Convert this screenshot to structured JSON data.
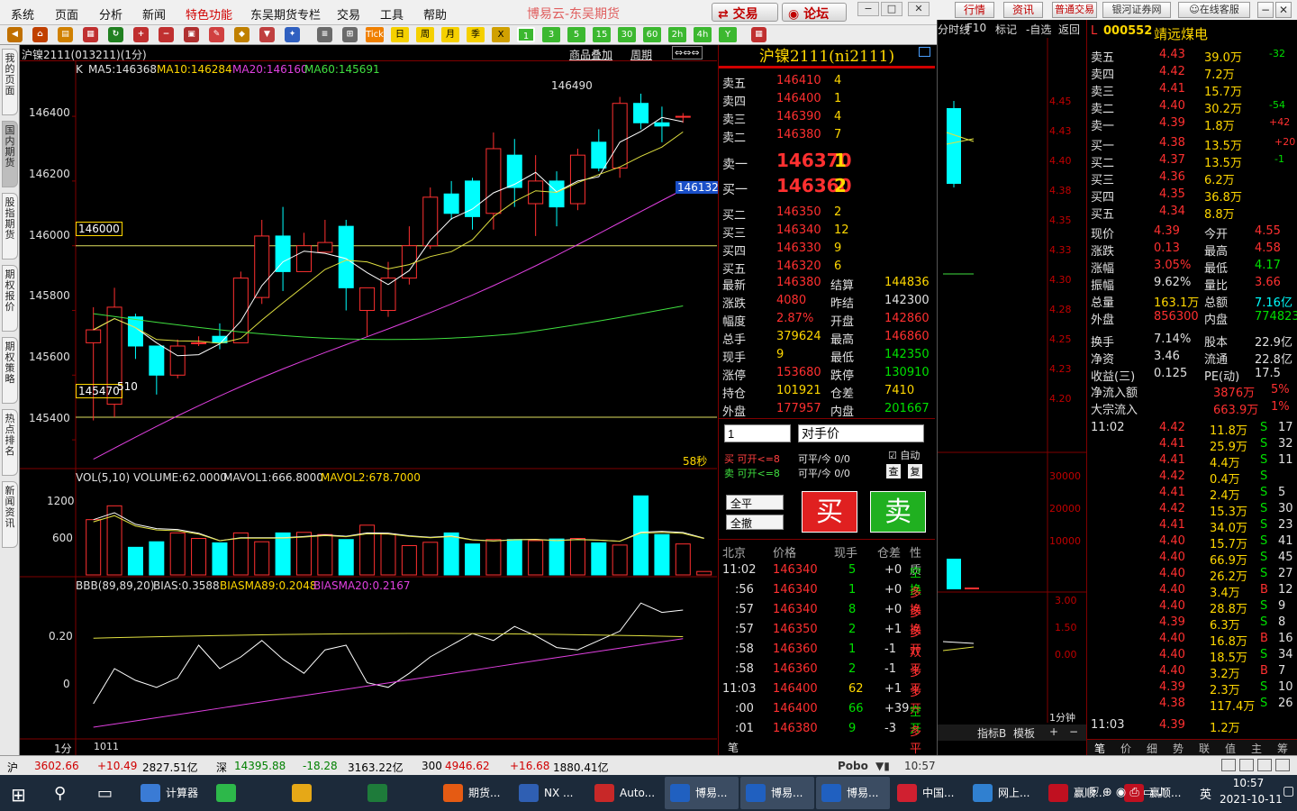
{
  "menu": {
    "items": [
      "系统",
      "页面",
      "分析",
      "新闻",
      "特色功能",
      "东吴期货专栏",
      "交易",
      "工具",
      "帮助"
    ],
    "title": "博易云-东吴期货",
    "trade_btn": "交易",
    "forum_btn": "论坛"
  },
  "toolbar": {
    "periods": [
      "1",
      "3",
      "5",
      "15",
      "30",
      "60",
      "2h",
      "4h",
      "Y"
    ],
    "tick": "Tick",
    "day": "日",
    "week": "周",
    "month": "月",
    "season": "季"
  },
  "sidetabs": [
    "我的页面",
    "国内期货",
    "股指期货",
    "期权报价",
    "期权策略",
    "热点排名",
    "新闻资讯"
  ],
  "chart": {
    "header": "沪镍2111(013211)(1分)",
    "overlay": "商品叠加",
    "period": "周期",
    "ma_label": "K",
    "ma5": "MA5:146368",
    "ma10": "MA10:146284",
    "ma20": "MA20:146160",
    "ma60": "MA60:145691",
    "high_label": "146490",
    "line1_label": "146000",
    "line2_label": "145470",
    "current_price_tag": "146132",
    "countdown": "58秒",
    "low_label_tail": "510",
    "vol_title": "VOL(5,10)",
    "vol_volume": "VOLUME:62.0000",
    "vol_mavol1": "MAVOL1:666.8000",
    "vol_mavol2": "MAVOL2:678.7000",
    "bbb_title": "BBB(89,89,20)",
    "bbb_bias": "BIAS:0.3588",
    "bbb_bma89": "BIASMA89:0.2048",
    "bbb_bma20": "BIASMA20:0.2167",
    "xaxis_period": "1分",
    "xaxis_time": "1011",
    "yticks": [
      "146400",
      "146200",
      "146000",
      "145800",
      "145600",
      "145400"
    ],
    "vol_yticks": [
      "1200",
      "600"
    ],
    "bbb_yticks": [
      "0.20",
      "0"
    ]
  },
  "chart_data": {
    "type": "candlestick",
    "title": "沪镍2111(013211)(1分)",
    "ylim": [
      145300,
      146520
    ],
    "candles": [
      [
        145700,
        145740,
        145500,
        145460,
        145810
      ],
      [
        145510,
        145810,
        145520,
        145470,
        145870
      ],
      [
        145780,
        145690,
        145690,
        145650,
        145790
      ],
      [
        145690,
        145600,
        145600,
        145540,
        145680
      ],
      [
        145600,
        145690,
        145690,
        145590,
        145710
      ],
      [
        145700,
        145700,
        145710,
        145690,
        145720
      ],
      [
        145720,
        145700,
        145730,
        145680,
        145760
      ],
      [
        145700,
        145900,
        145900,
        145700,
        145920
      ],
      [
        145840,
        146030,
        146030,
        145820,
        146080
      ],
      [
        146030,
        145920,
        145920,
        145860,
        146120
      ],
      [
        145920,
        146000,
        146000,
        145920,
        146040
      ],
      [
        145980,
        146010,
        146040,
        145980,
        146080
      ],
      [
        146060,
        145870,
        145870,
        145800,
        146080
      ],
      [
        145800,
        145870,
        145870,
        145720,
        145870
      ],
      [
        145800,
        145900,
        145900,
        145780,
        145950
      ],
      [
        145900,
        146000,
        146000,
        145880,
        146060
      ],
      [
        146000,
        146150,
        146150,
        145990,
        146180
      ],
      [
        146160,
        146100,
        146180,
        146080,
        146200
      ],
      [
        146200,
        146090,
        146200,
        146050,
        146210
      ],
      [
        146100,
        146300,
        146300,
        146050,
        146350
      ],
      [
        146280,
        146180,
        146280,
        146120,
        146330
      ],
      [
        146130,
        146200,
        146200,
        146030,
        146280
      ],
      [
        146200,
        146120,
        146220,
        146060,
        146230
      ],
      [
        146130,
        146280,
        146280,
        146110,
        146300
      ],
      [
        146320,
        146240,
        146350,
        146230,
        146360
      ],
      [
        146240,
        146440,
        146440,
        146210,
        146460
      ],
      [
        146440,
        146380,
        146440,
        146360,
        146470
      ],
      [
        146380,
        146370,
        146380,
        146320,
        146430
      ],
      [
        146400,
        146400,
        146410,
        146380,
        146410
      ]
    ],
    "volume": [
      1000,
      1250,
      500,
      600,
      760,
      660,
      580,
      760,
      600,
      760,
      770,
      730,
      640,
      900,
      740,
      530,
      590,
      760,
      560,
      640,
      640,
      620,
      650,
      660,
      580,
      540,
      1430,
      730,
      560,
      62
    ]
  },
  "orderbook": {
    "title": "沪镍2111(ni2111)",
    "asks": [
      {
        "label": "卖五",
        "price": "146410",
        "vol": "4"
      },
      {
        "label": "卖四",
        "price": "146400",
        "vol": "1"
      },
      {
        "label": "卖三",
        "price": "146390",
        "vol": "4"
      },
      {
        "label": "卖二",
        "price": "146380",
        "vol": "7"
      },
      {
        "label": "卖一",
        "price": "146370",
        "vol": "1"
      }
    ],
    "bids": [
      {
        "label": "买一",
        "price": "146360",
        "vol": "2"
      },
      {
        "label": "买二",
        "price": "146350",
        "vol": "2"
      },
      {
        "label": "买三",
        "price": "146340",
        "vol": "12"
      },
      {
        "label": "买四",
        "price": "146330",
        "vol": "9"
      },
      {
        "label": "买五",
        "price": "146320",
        "vol": "6"
      }
    ],
    "stats": [
      [
        "最新",
        "146380",
        "结算",
        "144836"
      ],
      [
        "涨跌",
        "4080",
        "昨结",
        "142300"
      ],
      [
        "幅度",
        "2.87%",
        "开盘",
        "142860"
      ],
      [
        "总手",
        "379624",
        "最高",
        "146860"
      ],
      [
        "现手",
        "9",
        "最低",
        "142350"
      ],
      [
        "涨停",
        "153680",
        "跌停",
        "130910"
      ],
      [
        "持仓",
        "101921",
        "仓差",
        "7410"
      ],
      [
        "外盘",
        "177957",
        "内盘",
        "201667"
      ]
    ],
    "qty": "1",
    "price_type": "对手价",
    "buy_open": "买 可开<=8",
    "sell_open": "卖 可开<=8",
    "close1": "可平/今 0/0",
    "close2": "可平/今 0/0",
    "auto": "自动",
    "check": "查",
    "repeat": "复",
    "all_close": "全平",
    "all_flat": "全撤",
    "buy_btn": "买",
    "sell_btn": "卖",
    "tick_headers": [
      "北京",
      "价格",
      "现手",
      "仓差",
      "性质"
    ],
    "ticks": [
      [
        "11:02",
        "146340",
        "5",
        "+0",
        "空换"
      ],
      [
        ":56",
        "146340",
        "1",
        "+0",
        "多换"
      ],
      [
        ":57",
        "146340",
        "8",
        "+0",
        "多换"
      ],
      [
        ":57",
        "146350",
        "2",
        "+1",
        "多开"
      ],
      [
        ":58",
        "146360",
        "1",
        "-1",
        "双平"
      ],
      [
        ":58",
        "146360",
        "2",
        "-1",
        "多平"
      ],
      [
        "11:03",
        "146400",
        "62",
        "+1",
        "多开"
      ],
      [
        ":00",
        "146400",
        "66",
        "+39",
        "空开"
      ],
      [
        ":01",
        "146380",
        "9",
        "-3",
        "多平"
      ]
    ],
    "tab": "笔"
  },
  "mini": {
    "tabs": [
      "分时线",
      "F10",
      "标记",
      "-自选",
      "返回"
    ],
    "yticks": [
      "4.45",
      "4.43",
      "4.40",
      "4.38",
      "4.35",
      "4.33",
      "4.30",
      "4.28",
      "4.25",
      "4.23",
      "4.20"
    ],
    "vol_yticks": [
      "30000",
      "20000",
      "10000"
    ],
    "ind_yticks": [
      "3.00",
      "1.50",
      "0.00"
    ],
    "period": "1分钟",
    "btns": [
      "指标B",
      "模板",
      "+",
      "−"
    ]
  },
  "right": {
    "topbtns": [
      "行情",
      "资讯",
      "普通交易",
      "银河证券网",
      "在线客服"
    ],
    "code": "000552",
    "name": "靖远煤电",
    "asks": [
      [
        "卖五",
        "4.43",
        "39.0万",
        "-32"
      ],
      [
        "卖四",
        "4.42",
        "7.2万",
        ""
      ],
      [
        "卖三",
        "4.41",
        "15.7万",
        ""
      ],
      [
        "卖二",
        "4.40",
        "30.2万",
        "-54"
      ],
      [
        "卖一",
        "4.39",
        "1.8万",
        "+42"
      ]
    ],
    "bids": [
      [
        "买一",
        "4.38",
        "13.5万",
        "+20"
      ],
      [
        "买二",
        "4.37",
        "13.5万",
        "-1"
      ],
      [
        "买三",
        "4.36",
        "6.2万",
        ""
      ],
      [
        "买四",
        "4.35",
        "36.8万",
        ""
      ],
      [
        "买五",
        "4.34",
        "8.8万",
        ""
      ]
    ],
    "stats": [
      [
        "现价",
        "4.39",
        "今开",
        "4.55"
      ],
      [
        "涨跌",
        "0.13",
        "最高",
        "4.58"
      ],
      [
        "涨幅",
        "3.05%",
        "最低",
        "4.17"
      ],
      [
        "振幅",
        "9.62%",
        "量比",
        "3.66"
      ],
      [
        "总量",
        "163.1万",
        "总额",
        "7.16亿"
      ],
      [
        "外盘",
        "856300",
        "内盘",
        "774823"
      ],
      [
        "换手",
        "7.14%",
        "股本",
        "22.9亿"
      ],
      [
        "净资",
        "3.46",
        "流通",
        "22.8亿"
      ],
      [
        "收益(三)",
        "0.125",
        "PE(动)",
        "17.5"
      ]
    ],
    "flow": [
      [
        "净流入额",
        "3876万",
        "5%"
      ],
      [
        "大宗流入",
        "663.9万",
        "1%"
      ]
    ],
    "trades": [
      [
        "11:02",
        "4.42",
        "11.8万",
        "S",
        "17"
      ],
      [
        "",
        "4.41",
        "25.9万",
        "S",
        "32"
      ],
      [
        "",
        "4.41",
        "4.4万",
        "S",
        "11"
      ],
      [
        "",
        "4.42",
        "0.4万",
        "S",
        ""
      ],
      [
        "",
        "4.41",
        "2.4万",
        "S",
        "5"
      ],
      [
        "",
        "4.42",
        "15.3万",
        "S",
        "30"
      ],
      [
        "",
        "4.41",
        "34.0万",
        "S",
        "23"
      ],
      [
        "",
        "4.40",
        "15.7万",
        "S",
        "41"
      ],
      [
        "",
        "4.40",
        "66.9万",
        "S",
        "45"
      ],
      [
        "",
        "4.40",
        "26.2万",
        "S",
        "27"
      ],
      [
        "",
        "4.40",
        "3.4万",
        "B",
        "12"
      ],
      [
        "",
        "4.40",
        "28.8万",
        "S",
        "9"
      ],
      [
        "",
        "4.39",
        "6.3万",
        "S",
        "8"
      ],
      [
        "",
        "4.40",
        "16.8万",
        "B",
        "16"
      ],
      [
        "",
        "4.40",
        "18.5万",
        "S",
        "34"
      ],
      [
        "",
        "4.40",
        "3.2万",
        "B",
        "7"
      ],
      [
        "",
        "4.39",
        "2.3万",
        "S",
        "10"
      ],
      [
        "",
        "4.38",
        "117.4万",
        "S",
        "26"
      ],
      [
        "11:03",
        "4.39",
        "1.2万",
        "",
        ""
      ]
    ],
    "bottomtabs": [
      "笔",
      "价",
      "细",
      "势",
      "联",
      "值",
      "主",
      "筹"
    ]
  },
  "status": {
    "sh_label": "沪",
    "sh_index": "3602.66",
    "sh_chg": "+10.49",
    "sh_amt": "2827.51亿",
    "sz_label": "深",
    "sz_index": "14395.88",
    "sz_chg": "-18.28",
    "sz_amt": "3163.22亿",
    "c300_label": "300",
    "c300_index": "4946.62",
    "c300_chg": "+16.68",
    "c300_amt": "1880.41亿",
    "brand": "Pobo",
    "time": "10:57"
  },
  "taskbar": {
    "apps": [
      "计算器",
      "",
      "",
      "",
      "期货...",
      "NX ...",
      "Auto...",
      "博易...",
      "博易...",
      "博易...",
      "中国...",
      "网上...",
      "赢顺...",
      "赢顺..."
    ],
    "time": "10:57",
    "date": "2021-10-11",
    "ime": "英"
  }
}
